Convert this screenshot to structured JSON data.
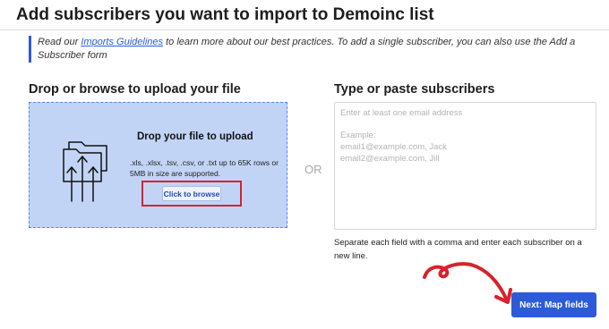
{
  "header": {
    "title": "Add subscribers you want to import to Demoinc list"
  },
  "info": {
    "prefix": "Read our ",
    "link_text": "Imports Guidelines",
    "suffix": " to learn more about our best practices. To add a single subscriber, you can also use the Add a Subscriber form"
  },
  "upload": {
    "section_title": "Drop or browse to upload your file",
    "drop_title": "Drop your file to upload",
    "description": ".xls, .xlsx, .tsv, .csv, or .txt up to 65K rows or 5MB in size are supported.",
    "browse_label": "Click to browse",
    "icon": "folder-upload-icon",
    "accent": "#c2d4f6"
  },
  "separator": {
    "label": "OR"
  },
  "paste": {
    "section_title": "Type or paste subscribers",
    "placeholder_line1": "Enter at least one email address",
    "placeholder_example_label": "Example:",
    "placeholder_example_1": "email1@example.com, Jack",
    "placeholder_example_2": "email2@example.com, Jill",
    "help_text": "Separate each field with a comma and enter each subscriber on a new line."
  },
  "footer": {
    "next_label": "Next: Map fields",
    "next_color": "#2d5bd7",
    "highlight_color": "#d8222a"
  }
}
